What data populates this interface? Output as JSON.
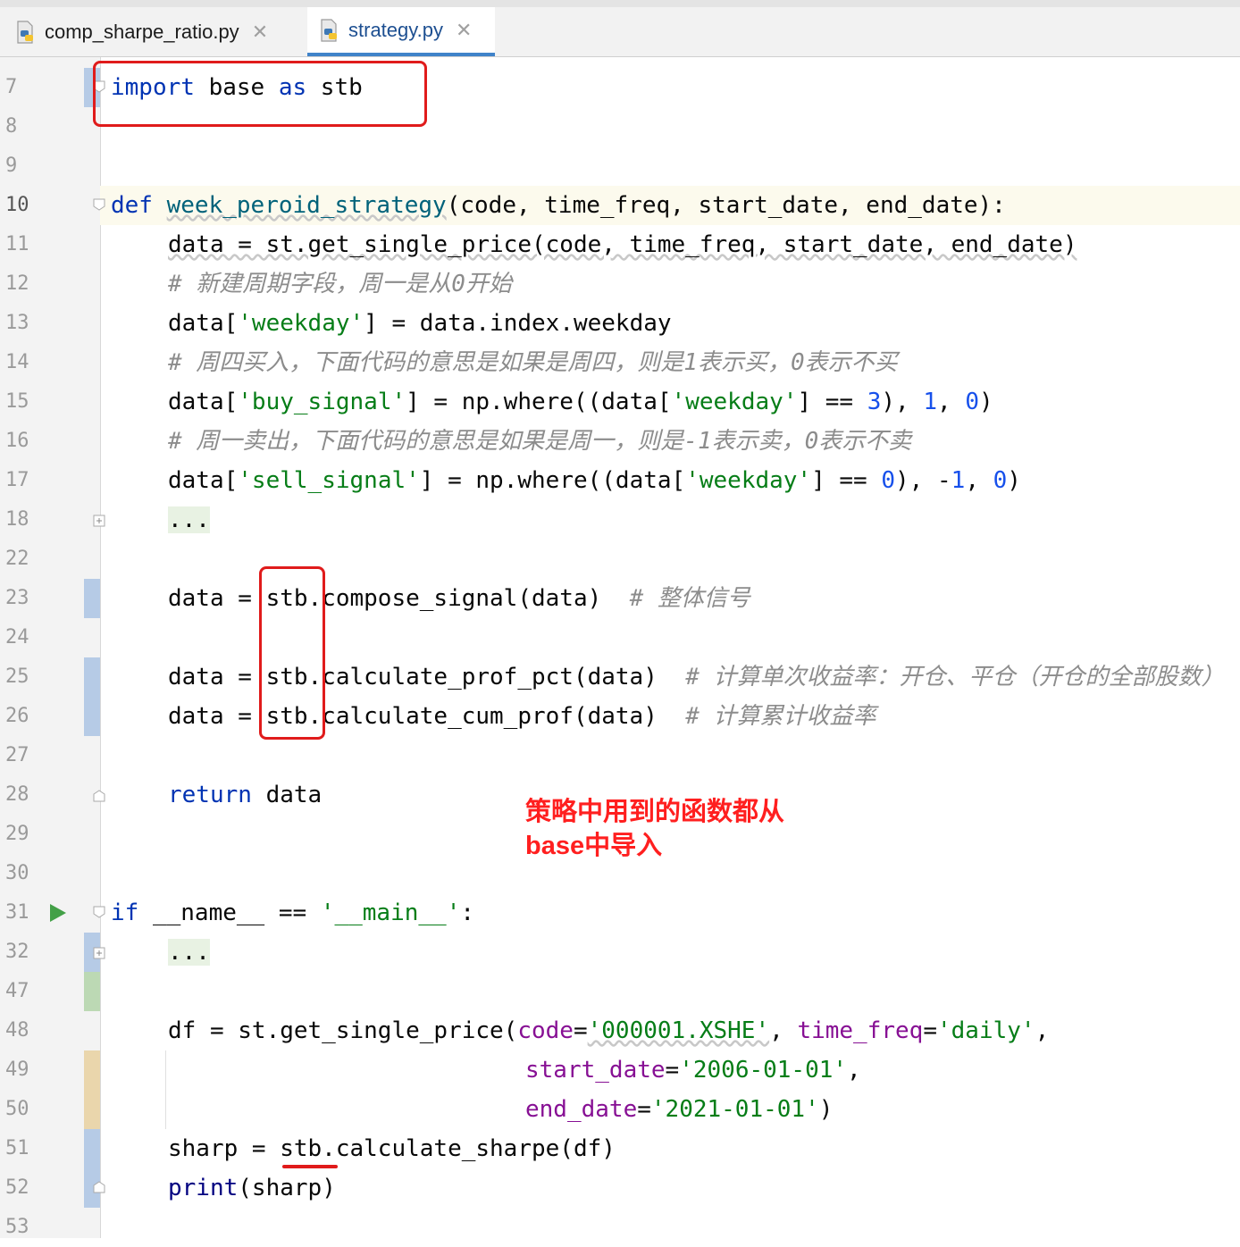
{
  "tabs": [
    {
      "label": "comp_sharpe_ratio.py",
      "icon": "python-file-icon",
      "active": false
    },
    {
      "label": "strategy.py",
      "icon": "python-file-icon",
      "active": true
    }
  ],
  "close_glyph": "✕",
  "line_numbers": [
    "7",
    "8",
    "9",
    "10",
    "11",
    "12",
    "13",
    "14",
    "15",
    "16",
    "17",
    "18",
    "22",
    "23",
    "24",
    "25",
    "26",
    "27",
    "28",
    "29",
    "30",
    "31",
    "32",
    "47",
    "48",
    "49",
    "50",
    "51",
    "52",
    "53"
  ],
  "code": {
    "l7": {
      "kw1": "import",
      "t1": " base ",
      "kw2": "as",
      "t2": " stb"
    },
    "l10": {
      "kw": "def",
      "fn": "week_peroid_strategy",
      "rest": "(code, time_freq, start_date, end_date):"
    },
    "l11": "data = st.get_single_price(code, time_freq, start_date, end_date)",
    "l12": "# 新建周期字段，周一是从0开始",
    "l13": {
      "a": "data[",
      "s": "'weekday'",
      "b": "] = data.index.weekday"
    },
    "l14": "# 周四买入，下面代码的意思是如果是周四，则是1表示买，0表示不买",
    "l15": {
      "a": "data[",
      "s1": "'buy_signal'",
      "b": "] = np.where((data[",
      "s2": "'weekday'",
      "c": "] == ",
      "n1": "3",
      "d": "), ",
      "n2": "1",
      "e": ", ",
      "n3": "0",
      "f": ")"
    },
    "l16": "# 周一卖出，下面代码的意思是如果是周一，则是-1表示卖，0表示不卖",
    "l17": {
      "a": "data[",
      "s1": "'sell_signal'",
      "b": "] = np.where((data[",
      "s2": "'weekday'",
      "c": "] == ",
      "n1": "0",
      "d": "), -",
      "n2": "1",
      "e": ", ",
      "n3": "0",
      "f": ")"
    },
    "ellipsis": "...",
    "l23": {
      "code": "data = stb.compose_signal(data)  ",
      "cmt": "# 整体信号"
    },
    "l25": {
      "code": "data = stb.calculate_prof_pct(data)  ",
      "cmt": "# 计算单次收益率：开仓、平仓（开仓的全部股数）"
    },
    "l26": {
      "code": "data = stb.calculate_cum_prof(data)  ",
      "cmt": "# 计算累计收益率"
    },
    "l28": {
      "kw": "return",
      "rest": " data"
    },
    "l31": {
      "kw": "if",
      "a": " __name__ == ",
      "s": "'__main__'",
      "b": ":"
    },
    "l48": {
      "a": "df = st.get_single_price(",
      "p1": "code",
      "eq1": "=",
      "s1": "'000001.XSHE'",
      "c1": ", ",
      "p2": "time_freq",
      "eq2": "=",
      "s2": "'daily'",
      "c2": ","
    },
    "l49": {
      "p": "start_date",
      "eq": "=",
      "s": "'2006-01-01'",
      "c": ","
    },
    "l50": {
      "p": "end_date",
      "eq": "=",
      "s": "'2021-01-01'",
      "c": ")"
    },
    "l51": "sharp = stb.calculate_sharpe(df)",
    "l52": {
      "bi": "print",
      "rest": "(sharp)"
    }
  },
  "annotation": {
    "line1": "策略中用到的函数都从",
    "line2": "base中导入"
  },
  "colors": {
    "accent": "#4083c9",
    "annotation": "#ff1f1f",
    "keyword": "#0033b3",
    "string": "#067d17",
    "number": "#1750eb",
    "comment": "#8c8c8c",
    "param": "#871094"
  }
}
